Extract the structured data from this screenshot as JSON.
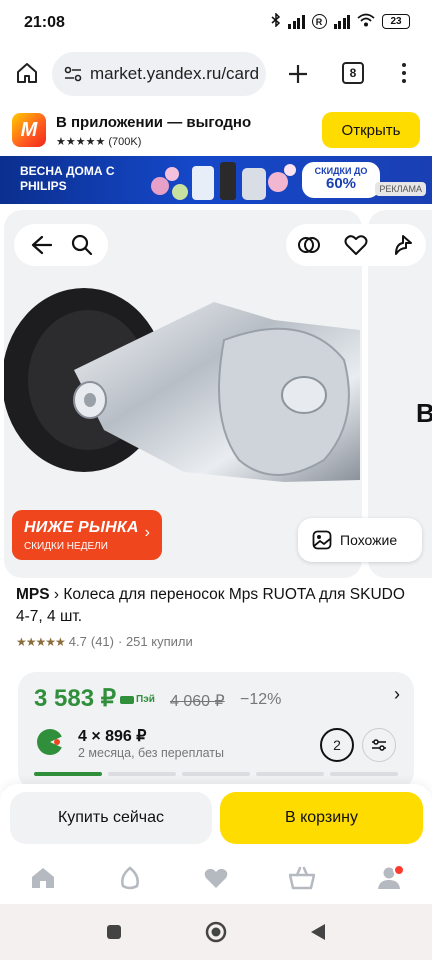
{
  "status_bar": {
    "time": "21:08",
    "battery": "23",
    "r_badge": "R"
  },
  "browser": {
    "url": "market.yandex.ru/card",
    "tab_count": "8"
  },
  "app_banner": {
    "title": "В приложении — выгодно",
    "stars": "★★★★★",
    "reviews": "(700K)",
    "open_label": "Открыть",
    "logo_letter": "M"
  },
  "ad_banner": {
    "title": "ВЕСНА ДОМА С PHILIPS",
    "discount_small": "СКИДКИ ДО",
    "discount_big": "60%",
    "ad_label": "РЕКЛАМА"
  },
  "gallery": {
    "next_card_letter": "В",
    "promo_title": "НИЖЕ РЫНКА",
    "promo_subtitle": "СКИДКИ НЕДЕЛИ",
    "promo_arrow": "›",
    "similar_label": "Похожие"
  },
  "product": {
    "brand": "MPS",
    "separator": " › ",
    "title": "Колеса для переносок Mps RUOTA для SKUDO 4-7, 4 шт.",
    "stars": "★★★★★",
    "rating": "4.7",
    "reviews": "(41)",
    "bought": "· 251 купили"
  },
  "price": {
    "current": "3 583 ₽",
    "pay_label": "Пэй",
    "old": "4 060 ₽",
    "discount": "−12%",
    "chevron": "›",
    "split_price": "4 × 896 ₽",
    "split_note": "2 месяца, без переплаты",
    "months": "2",
    "progress_segments": 5,
    "progress_active": 1
  },
  "actions": {
    "buy_now": "Купить сейчас",
    "add_to_cart": "В корзину"
  },
  "tabs": [
    "home-icon",
    "alice-icon",
    "heart-icon",
    "cart-icon",
    "profile-icon"
  ],
  "colors": {
    "accent_yellow": "#ffdc00",
    "price_green": "#2f8f3a",
    "promo_red": "#f0461e",
    "ad_blue": "#1548c9"
  }
}
